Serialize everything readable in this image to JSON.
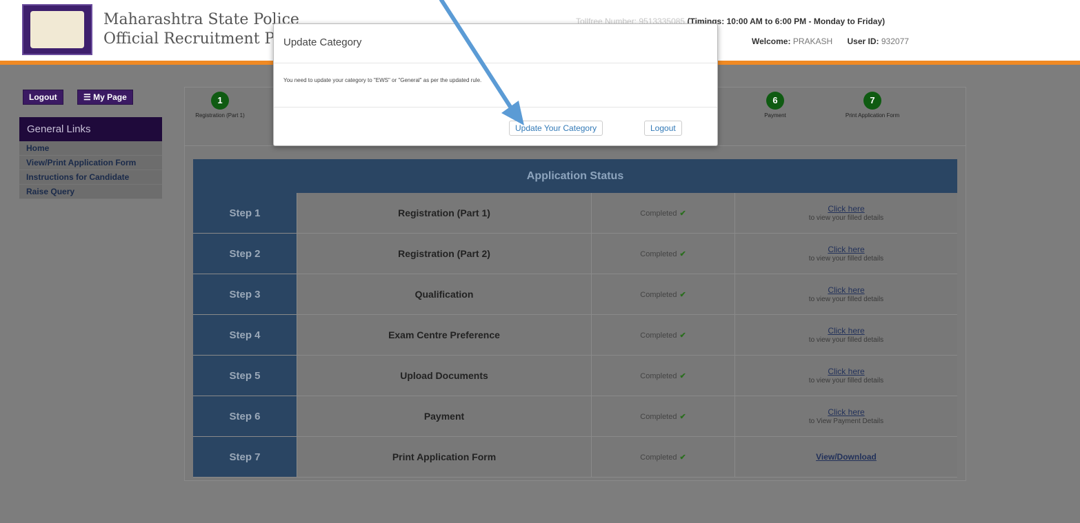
{
  "header": {
    "brand_line1": "Maharashtra State Police",
    "brand_line2": "Official Recruitment Portal",
    "tollfree_masked": "Tollfree Number: 9513335085",
    "tollfree_timings": "(Timings: 10:00 AM to 6:00 PM - Monday to Friday)",
    "welcome_label": "Welcome:",
    "welcome_name": "PRAKASH",
    "userid_label": "User ID:",
    "userid_value": "932077"
  },
  "topbuttons": {
    "logout": "Logout",
    "mypage": "My Page"
  },
  "sidebar": {
    "title": "General Links",
    "items": [
      {
        "label": "Home"
      },
      {
        "label": "View/Print Application Form"
      },
      {
        "label": "Instructions for Candidate"
      },
      {
        "label": "Raise Query"
      }
    ]
  },
  "wizard": {
    "steps": [
      {
        "num": "1",
        "label": "Registration (Part 1)"
      },
      {
        "num": "6",
        "label": "Payment"
      },
      {
        "num": "7",
        "label": "Print Application Form"
      }
    ]
  },
  "status": {
    "title": "Application Status",
    "rows": [
      {
        "step": "Step 1",
        "name": "Registration (Part 1)",
        "status": "Completed",
        "link": "Click here",
        "sub": "to view your filled details"
      },
      {
        "step": "Step 2",
        "name": "Registration (Part 2)",
        "status": "Completed",
        "link": "Click here",
        "sub": "to view your filled details"
      },
      {
        "step": "Step 3",
        "name": "Qualification",
        "status": "Completed",
        "link": "Click here",
        "sub": "to view your filled details"
      },
      {
        "step": "Step 4",
        "name": "Exam Centre Preference",
        "status": "Completed",
        "link": "Click here",
        "sub": "to view your filled details"
      },
      {
        "step": "Step 5",
        "name": "Upload Documents",
        "status": "Completed",
        "link": "Click here",
        "sub": "to view your filled details"
      },
      {
        "step": "Step 6",
        "name": "Payment",
        "status": "Completed",
        "link": "Click here",
        "sub": "to View Payment Details"
      },
      {
        "step": "Step 7",
        "name": "Print Application Form",
        "status": "Completed",
        "link": "View/Download",
        "sub": ""
      }
    ]
  },
  "modal": {
    "title": "Update Category",
    "body": "You need to update your category to \"EWS\" or \"General\" as per the updated rule.",
    "primary": "Update Your Category",
    "secondary": "Logout"
  },
  "colors": {
    "accent_orange": "#f08a24",
    "nav_purple": "#3b1a63",
    "status_blue": "#2a4563",
    "arrow": "#5b9bd5"
  }
}
